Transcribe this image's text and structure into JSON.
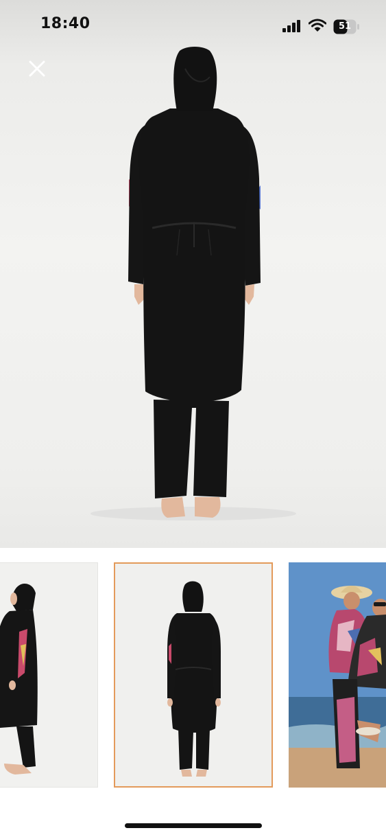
{
  "status_bar": {
    "time": "18:40",
    "battery_level": "51",
    "icons": [
      "signal-icon",
      "wifi-icon",
      "battery-icon"
    ]
  },
  "viewer": {
    "close_icon": "close-icon",
    "main_image": "product-photo-back-view"
  },
  "thumbnails": {
    "selected_index": 1,
    "selected_border_color": "#e39a5a",
    "items": [
      {
        "image": "product-photo-side-view"
      },
      {
        "image": "product-photo-back-view"
      },
      {
        "image": "beach-lifestyle-photo"
      }
    ]
  },
  "colors": {
    "garment": "#141414",
    "background": "#f2f2f0",
    "sky": "#5f92c9"
  }
}
